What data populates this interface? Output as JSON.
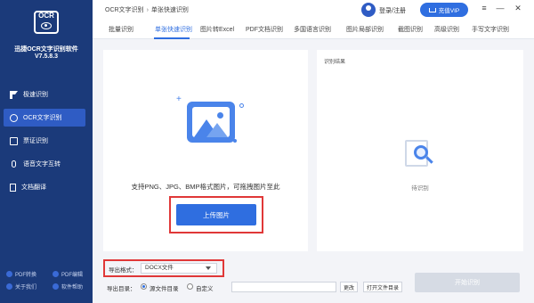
{
  "sidebar": {
    "logo_text": "OCR",
    "app_name": "迅捷OCR文字识别软件",
    "version": "V7.5.8.3",
    "nav": [
      {
        "label": "极速识别",
        "icon": "bolt-icon",
        "active": false
      },
      {
        "label": "OCR文字识别",
        "icon": "ocr-icon",
        "active": true
      },
      {
        "label": "票证识别",
        "icon": "ticket-icon",
        "active": false
      },
      {
        "label": "语音文字互转",
        "icon": "mic-icon",
        "active": false
      },
      {
        "label": "文档翻译",
        "icon": "doc-icon",
        "active": false
      }
    ],
    "tools": [
      {
        "label": "PDF转换",
        "icon": "pdf-convert-icon"
      },
      {
        "label": "PDF编辑",
        "icon": "pdf-edit-icon"
      },
      {
        "label": "关于我们",
        "icon": "about-icon"
      },
      {
        "label": "软件帮助",
        "icon": "help-icon"
      }
    ]
  },
  "titlebar": {
    "breadcrumb": [
      "OCR文字识别",
      "单张快速识别"
    ],
    "login": "登录/注册",
    "vip": "充值VIP"
  },
  "tabs": [
    {
      "label": "批量识别",
      "active": false
    },
    {
      "label": "单张快速识别",
      "active": true
    },
    {
      "label": "图片转Excel",
      "active": false
    },
    {
      "label": "PDF文档识别",
      "active": false
    },
    {
      "label": "多国语言识别",
      "active": false
    },
    {
      "label": "图片局部识别",
      "active": false
    },
    {
      "label": "截图识别",
      "active": false
    },
    {
      "label": "高级识别",
      "active": false
    },
    {
      "label": "手写文字识别",
      "active": false
    }
  ],
  "upload": {
    "hint": "支持PNG、JPG、BMP格式图片，可拖拽图片至此",
    "button": "上传图片"
  },
  "result": {
    "title": "识别结果",
    "status": "待识别"
  },
  "controls": {
    "format_label": "导出格式：",
    "format_value": "DOCX文件",
    "dir_label": "导出目录：",
    "dir_option_source": "源文件目录",
    "dir_option_custom": "自定义",
    "change_button": "更改",
    "open_folder_button": "打开文件目录",
    "start_button": "开始识别"
  },
  "colors": {
    "sidebar_bg": "#1b3a7a",
    "accent": "#2f6ee0",
    "highlight_border": "#e03838"
  }
}
